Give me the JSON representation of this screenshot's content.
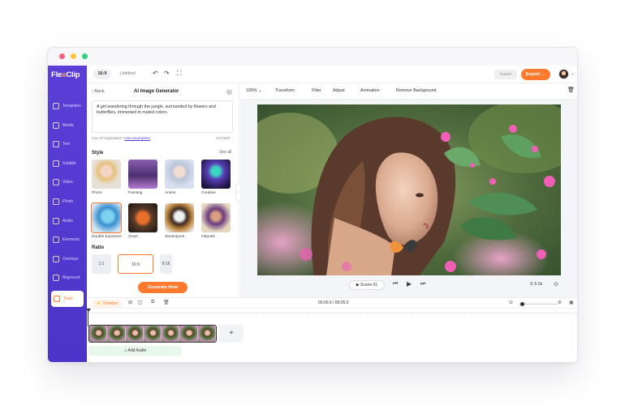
{
  "app": {
    "logo_prefix": "Fle",
    "logo_x": "x",
    "logo_suffix": "Clip"
  },
  "colors": {
    "accent": "#ff7a2f",
    "sidebar": "#5b3fd8",
    "dot_red": "#ff5f7e",
    "dot_yellow": "#ffc23a",
    "dot_green": "#2fd17a"
  },
  "sidebar": {
    "items": [
      {
        "label": "Templates",
        "icon": "templates-icon"
      },
      {
        "label": "Media",
        "icon": "media-icon"
      },
      {
        "label": "Text",
        "icon": "text-icon"
      },
      {
        "label": "Subtitle",
        "icon": "subtitle-icon"
      },
      {
        "label": "Video",
        "icon": "video-icon"
      },
      {
        "label": "Photo",
        "icon": "photo-icon"
      },
      {
        "label": "Audio",
        "icon": "audio-icon"
      },
      {
        "label": "Elements",
        "icon": "elements-icon"
      },
      {
        "label": "Overlays",
        "icon": "overlays-icon"
      },
      {
        "label": "Bkground",
        "icon": "background-icon"
      },
      {
        "label": "Tools",
        "icon": "tools-icon",
        "active": true
      }
    ]
  },
  "topbar": {
    "ratio": "16:9",
    "title": "Untitled",
    "undo": "↶",
    "redo": "↷",
    "fullscreen": "⛶",
    "saved": "Saved",
    "export": "Export →"
  },
  "panel": {
    "back": "‹  Back",
    "title": "AI Image Generator",
    "help": "?",
    "prompt": "A girl wandering through the jungle, surrounded by flowers and butterflies, immersed in muted colors.",
    "inspiration": "Out of inspiration?",
    "use_examples": "Use examples!",
    "char_count": "101/500",
    "style_heading": "Style",
    "see_all": "See all",
    "styles": [
      "Photo",
      "Painting",
      "Anime",
      "Creative",
      "Double Exposure",
      "Voxel",
      "Steampunk",
      "Inkpunk"
    ],
    "selected_style": "Double Exposure",
    "ratio_heading": "Ratio",
    "ratios": [
      "1:1",
      "16:9",
      "9:16"
    ],
    "selected_ratio": "16:9",
    "generate": "Generate Now",
    "collapse": "‹"
  },
  "editor": {
    "zoom": "100% ⌄",
    "tools": [
      "Transform",
      "Filter",
      "Adjust",
      "Animation",
      "Remove Background"
    ],
    "delete": "🗑"
  },
  "player": {
    "scene": "▶  Scene 01",
    "prev": "⏮",
    "play": "▶",
    "next": "⏭",
    "duration": "⏱ 5.0s",
    "fit": "⊙"
  },
  "timeline": {
    "tab": "⚡ Timeline",
    "time": "00:00.0 / 00:05.0",
    "add_clip": "+",
    "add_audio": "♫  Add Audio",
    "zoom_level": 0.05
  }
}
